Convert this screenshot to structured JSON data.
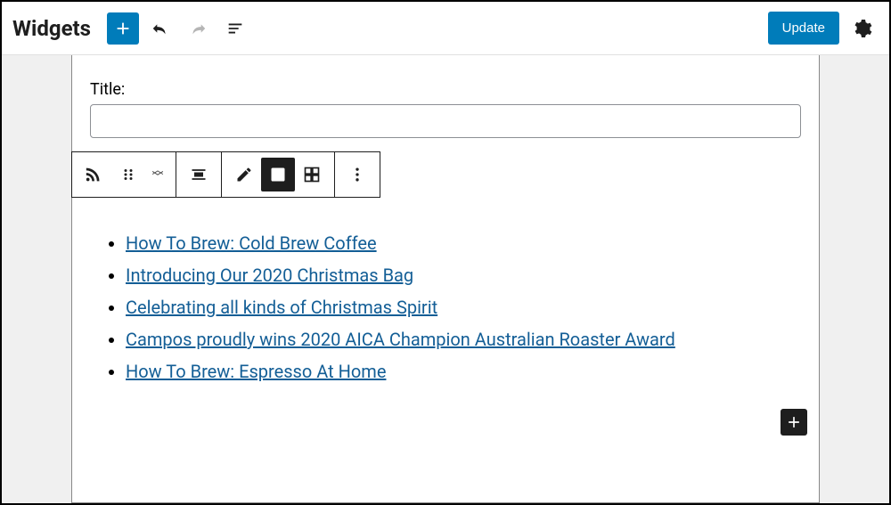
{
  "header": {
    "page_title": "Widgets",
    "update_label": "Update"
  },
  "widget": {
    "title_label": "Title:",
    "title_value": ""
  },
  "rss_feed": {
    "items": [
      "How To Brew: Cold Brew Coffee",
      "Introducing Our 2020 Christmas Bag",
      "Celebrating all kinds of Christmas Spirit",
      "Campos proudly wins 2020 AICA Champion Australian Roaster Award",
      "How To Brew: Espresso At Home"
    ]
  },
  "icons": {
    "add": "plus",
    "undo": "undo",
    "redo": "redo",
    "list_view": "list-view",
    "settings": "gear",
    "block_type": "rss",
    "drag": "drag",
    "align": "align",
    "edit": "pencil",
    "default_view": "list-bullets",
    "grid_view": "grid",
    "more": "kebab"
  }
}
